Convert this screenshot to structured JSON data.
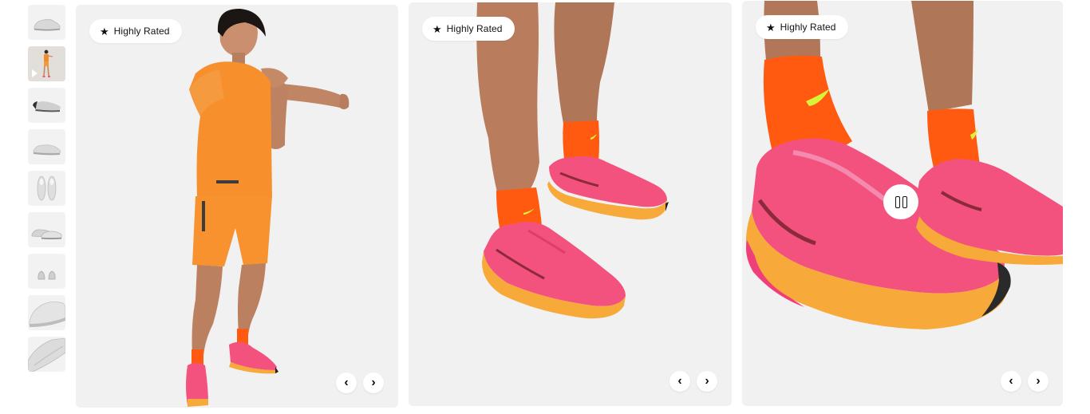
{
  "thumbnails": [
    {
      "icon": "shoe-side-icon"
    },
    {
      "icon": "model-video-icon",
      "active": true,
      "video": true
    },
    {
      "icon": "shoe-sole-icon"
    },
    {
      "icon": "shoe-side-icon"
    },
    {
      "icon": "shoe-top-pair-icon"
    },
    {
      "icon": "shoe-pair-icon"
    },
    {
      "icon": "shoe-front-pair-icon"
    },
    {
      "icon": "shoe-closeup-icon"
    },
    {
      "icon": "shoe-detail-icon"
    }
  ],
  "panels": [
    {
      "badge": "Highly Rated",
      "prev": "‹",
      "next": "›"
    },
    {
      "badge": "Highly Rated",
      "prev": "‹",
      "next": "›"
    },
    {
      "badge": "Highly Rated",
      "prev": "‹",
      "next": "›"
    }
  ],
  "badge_star": "★",
  "colors": {
    "shoe_pink": "#f4527e",
    "shoe_orange": "#f7a93a",
    "apparel_orange": "#f78f2d",
    "sock_orange": "#ff5a10",
    "swoosh_yellow": "#d9f23a",
    "panel_bg": "#f1f1f1"
  }
}
